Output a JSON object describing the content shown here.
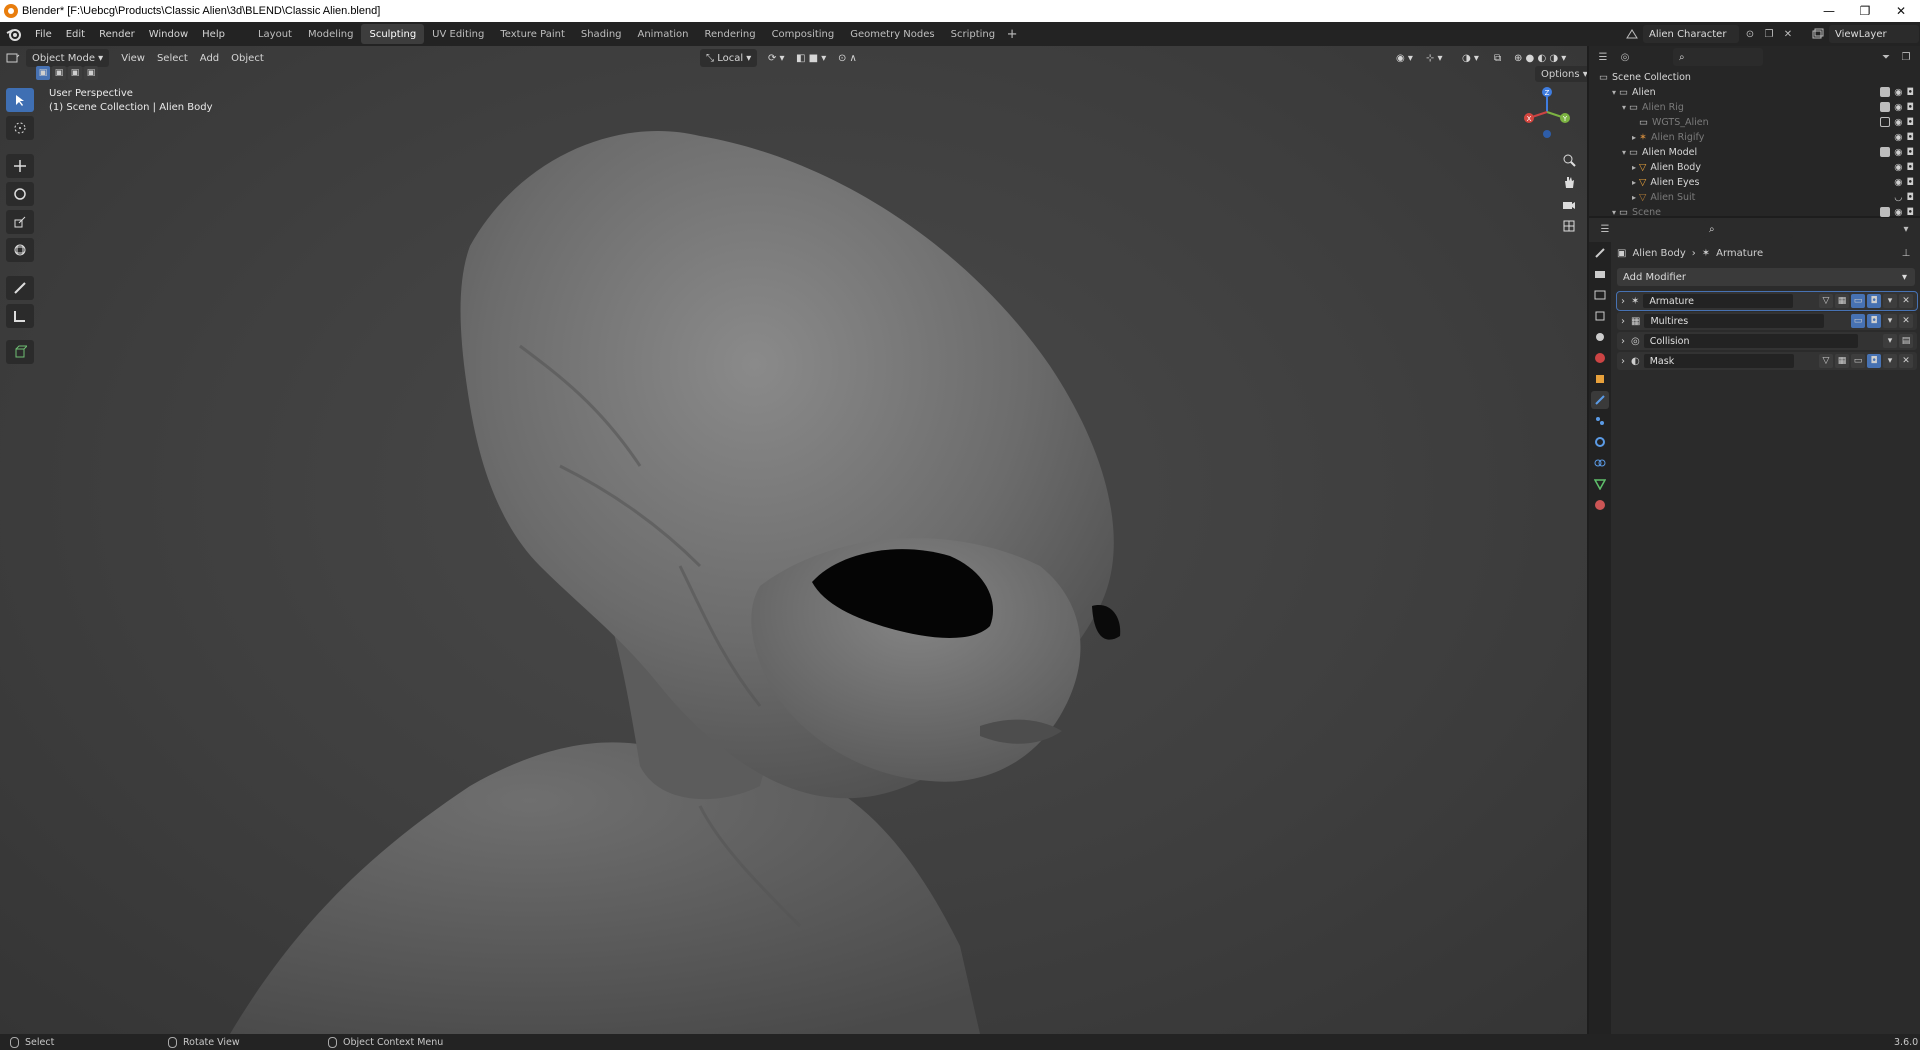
{
  "window": {
    "title": "Blender* [F:\\Uebcg\\Products\\Classic Alien\\3d\\BLEND\\Classic Alien.blend]",
    "controls": [
      "—",
      "❐",
      "✕"
    ]
  },
  "menubar": {
    "items": [
      "File",
      "Edit",
      "Render",
      "Window",
      "Help"
    ],
    "workspaces": [
      "Layout",
      "Modeling",
      "Sculpting",
      "UV Editing",
      "Texture Paint",
      "Shading",
      "Animation",
      "Rendering",
      "Compositing",
      "Geometry Nodes",
      "Scripting"
    ],
    "active_workspace": "Sculpting",
    "add_tab": "+",
    "scene": "Alien Character",
    "view_layer": "ViewLayer"
  },
  "viewport": {
    "mode": "Object Mode",
    "menus": [
      "View",
      "Select",
      "Add",
      "Object"
    ],
    "transform_orientation": "Local",
    "view_name": "User Perspective",
    "collection_info": "(1) Scene Collection | Alien Body",
    "options_label": "Options",
    "gizmo": {
      "x": "X",
      "y": "Y",
      "z": "Z"
    }
  },
  "outliner": {
    "root": "Scene Collection",
    "rows": [
      {
        "name": "Alien",
        "dim": false
      },
      {
        "name": "Alien Rig",
        "dim": true
      },
      {
        "name": "WGTS_Alien",
        "dim": true
      },
      {
        "name": "Alien Rigify",
        "dim": true
      },
      {
        "name": "Alien Model",
        "dim": false
      },
      {
        "name": "Alien Body",
        "dim": false
      },
      {
        "name": "Alien Eyes",
        "dim": false
      },
      {
        "name": "Alien Suit",
        "dim": true
      },
      {
        "name": "Scene",
        "dim": true
      }
    ]
  },
  "properties": {
    "breadcrumb_object": "Alien Body",
    "breadcrumb_modifier": "Armature",
    "add_modifier": "Add Modifier",
    "modifiers": [
      "Armature",
      "Multires",
      "Collision",
      "Mask"
    ]
  },
  "statusbar": {
    "select": "Select",
    "rotate": "Rotate View",
    "context": "Object Context Menu",
    "version": "3.6.0"
  },
  "colors": {
    "accent": "#4772b3",
    "orange": "#e87d0d",
    "viewport_bg": "#3f3f3f"
  }
}
